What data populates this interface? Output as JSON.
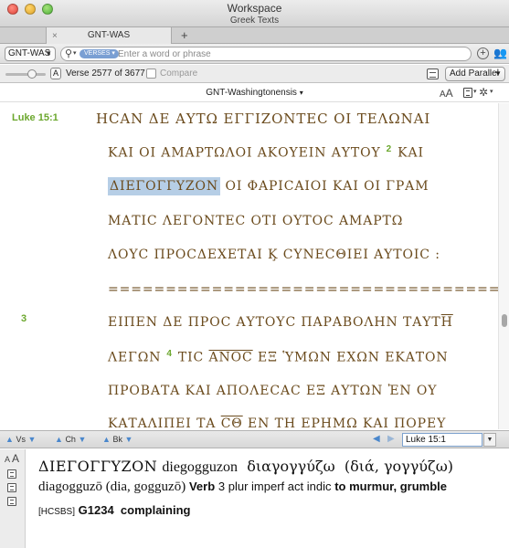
{
  "window": {
    "title": "Workspace",
    "subtitle": "Greek Texts"
  },
  "tabs": [
    {
      "label": "GNT-WAS",
      "close": "×"
    }
  ],
  "tab_add": "+",
  "toolbar": {
    "module_select": "GNT-WAS",
    "search_scope": "VERSES",
    "search_placeholder": "Enter a word or phrase",
    "add_tab_icon": "+",
    "users_icon": "👥"
  },
  "navrow": {
    "a_button": "A",
    "verse_count": "Verse 2577 of 3677",
    "compare_label": "Compare",
    "add_parallel": "Add Parallel"
  },
  "panel": {
    "title": "GNT-Washingtonensis",
    "font_small": "A",
    "font_big": "A"
  },
  "passage": {
    "ref": "Luke 15:1",
    "verse3_label": "3",
    "lines": [
      {
        "segments": [
          {
            "t": "ΗCΑΝ ΔΕ ΑΥΤΩ ΕΓΓΙΖΟΝΤΕC ΟΙ ΤΕΛΩΝΑΙ"
          }
        ]
      },
      {
        "segments": [
          {
            "t": "ΚΑΙ ΟΙ ΑΜΑΡΤΩΛΟΙ ΑΚΟΥΕΙΝ ΑΥΤΟΥ"
          }
        ],
        "verse": "2",
        "after": "ΚΑΙ"
      },
      {
        "highlight": "ΔΙΕΓΟΓΓΥΖΟΝ",
        "rest": "ΟΙ ΦΑΡΙCΑΙΟΙ ΚΑΙ ΟΙ ΓΡΑΜ"
      },
      {
        "segments": [
          {
            "t": "ΜΑΤΙC ΛΕΓΟΝΤΕC ΟΤΙ ΟΥΤΟC ΑΜΑΡΤΩ"
          }
        ]
      },
      {
        "segments": [
          {
            "t": "ΛΟΥC ΠΡΟCΔΕΧΕΤΑΙ Κ̧ CΥΝΕCΘΙΕΙ ΑΥΤΟΙC :"
          }
        ]
      },
      {
        "segments": [
          {
            "t": "========================================"
          }
        ]
      },
      {
        "segments": [
          {
            "t": "ΕΙΠΕΝ ΔΕ ΠΡΟC ΑΥΤΟΥC ΠΑΡΑΒΟΛΗΝ ΤΑΥΤ",
            "ovl": "Η"
          }
        ]
      },
      {
        "before": "ΛΕΓΩΝ",
        "verse": "4",
        "tis": "ΤΙC",
        "anos": "ΑΝΟC",
        "rest": "ΕΞ ὙΜΩΝ ΕΧΩΝ ΕΚΑΤΟΝ"
      },
      {
        "segments": [
          {
            "t": "ΠΡΟΒΑΤΑ ΚΑΙ ΑΠΟΛΕCΑC ΕΞ ΑΥΤΩΝ ἘΝ ΟΥ"
          }
        ]
      },
      {
        "before": "ΚΑΤΑΛΙΠΕΙ ΤΑ",
        "ce": "ϹΘ",
        "rest": "ΕΝ ΤΗ ΕΡΗΜΩ ΚΑΙ ΠΟΡΕΥ"
      }
    ]
  },
  "bottom_nav": {
    "verse": "Vs",
    "chapter": "Ch",
    "book": "Bk",
    "ref_value": "Luke 15:1"
  },
  "info": {
    "font_small": "A",
    "font_big": "A",
    "word": "ΔΙΕΓΟΓΓΥΖΟΝ",
    "translit": "diegogguzon",
    "lemma": "διαγογγύζω",
    "etym": "(διά, γογγύζω)",
    "lemma_translit": "diagogguzō (dia, gogguzō)",
    "pos": "Verb",
    "morph": "3 plur imperf act indic",
    "gloss": "to murmur, grumble",
    "source": "[HCSBS]",
    "strongs": "G1234",
    "definition": "complaining"
  },
  "colors": {
    "accent_blue": "#4a87cc",
    "verse_green": "#6ba72d",
    "text_brown": "#6b4b1d",
    "highlight": "#b6cee6"
  }
}
